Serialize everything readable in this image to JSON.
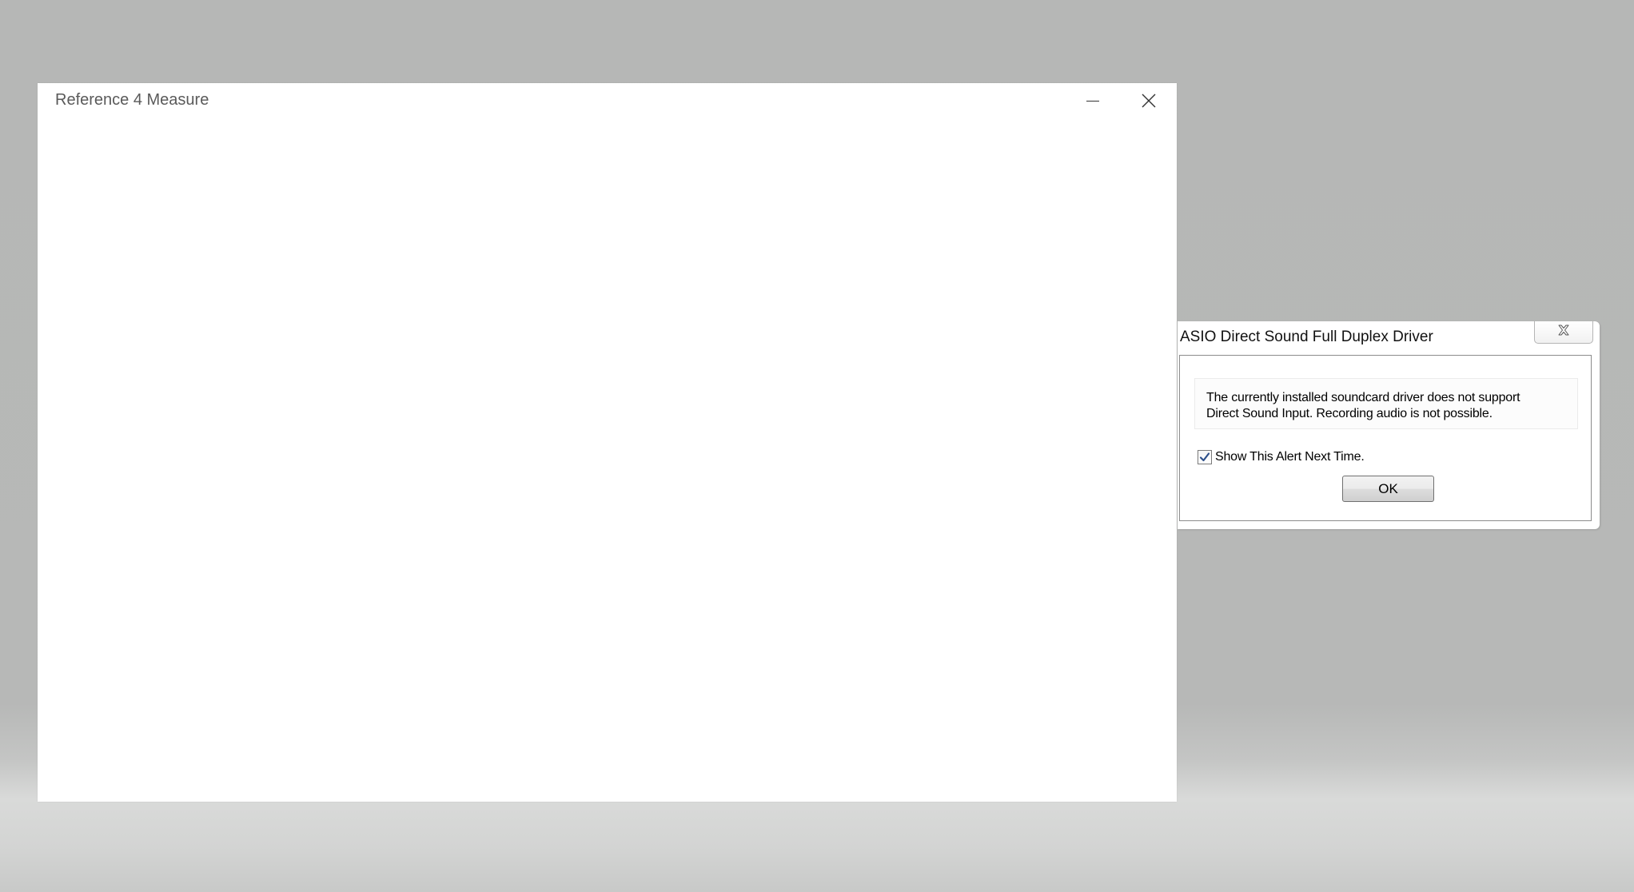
{
  "main_window": {
    "title": "Reference 4 Measure",
    "minimize_icon": "minimize-icon",
    "close_icon": "close-icon"
  },
  "alert_dialog": {
    "title": "ASIO Direct Sound Full Duplex Driver",
    "close_icon": "close-icon",
    "message_line1": "The currently installed soundcard driver does not support",
    "message_line2": "Direct Sound Input. Recording audio is not possible.",
    "checkbox_label": "Show This Alert Next Time.",
    "checkbox_checked": true,
    "ok_label": "OK"
  },
  "colors": {
    "desktop_background": "#b6b7b6",
    "window_background": "#ffffff",
    "checkmark": "#2d4f8a"
  }
}
